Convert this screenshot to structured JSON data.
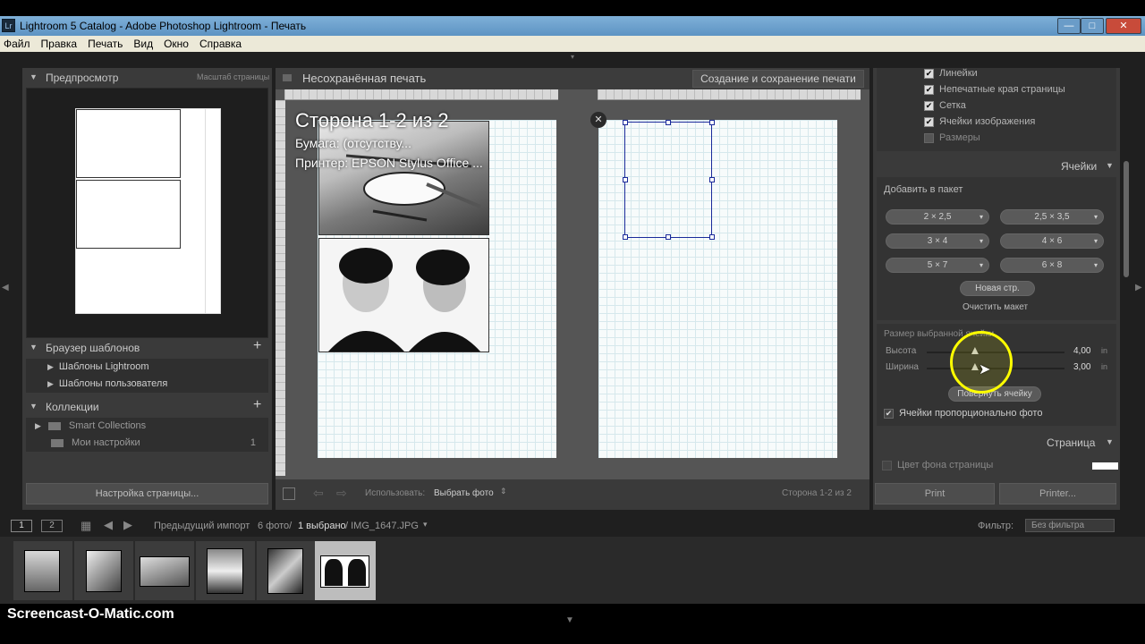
{
  "window": {
    "title": "Lightroom 5 Catalog - Adobe Photoshop Lightroom - Печать",
    "app_icon": "Lr",
    "minimize": "—",
    "maximize": "□",
    "close": "✕"
  },
  "menu": [
    "Файл",
    "Правка",
    "Печать",
    "Вид",
    "Окно",
    "Справка"
  ],
  "left": {
    "preview_title": "Предпросмотр",
    "preview_scale": "Масштаб страницы",
    "template_browser": "Браузер шаблонов",
    "templates": [
      "Шаблоны Lightroom",
      "Шаблоны пользователя"
    ],
    "collections_title": "Коллекции",
    "collections": [
      {
        "name": "Smart Collections",
        "count": ""
      },
      {
        "name": "Мои настройки",
        "count": "1"
      }
    ],
    "page_setup": "Настройка страницы..."
  },
  "center": {
    "title": "Несохранённая печать",
    "create_button": "Создание и сохранение печати",
    "overlay_title": "Сторона 1-2 из 2",
    "overlay_paper": "Бумага:  (отсутству...",
    "overlay_printer": "Принтер:  EPSON Stylus Office ...",
    "toolbar_use_label": "Использовать:",
    "toolbar_use_value": "Выбрать фото",
    "page_indicator": "Сторона 1-2 из 2"
  },
  "right": {
    "guides": [
      {
        "label": "Линейки",
        "checked": true
      },
      {
        "label": "Непечатные края страницы",
        "checked": true
      },
      {
        "label": "Сетка",
        "checked": true
      },
      {
        "label": "Ячейки изображения",
        "checked": true
      },
      {
        "label": "Размеры",
        "checked": false
      }
    ],
    "cells_title": "Ячейки",
    "add_to_package": "Добавить в пакет",
    "sizes": [
      "2 × 2,5",
      "2,5 × 3,5",
      "3 × 4",
      "4 × 6",
      "5 × 7",
      "6 × 8"
    ],
    "new_page": "Новая стр.",
    "clear_layout": "Очистить макет",
    "selected_cell_size": "Размер выбранной ячейки",
    "height_label": "Высота",
    "height_value": "4,00",
    "width_label": "Ширина",
    "width_value": "3,00",
    "unit": "in",
    "height_fraction": 0.35,
    "width_fraction": 0.35,
    "rotate_cell": "Повернуть ячейку",
    "cells_proportional": "Ячейки пропорционально фото",
    "page_title": "Страница",
    "page_bg_color": "Цвет фона страницы",
    "print_button": "Print",
    "printer_button": "Printer..."
  },
  "filmstrip": {
    "view1": "1",
    "view2": "2",
    "source": "Предыдущий импорт",
    "count": "6 фото/",
    "selected": "1 выбрано",
    "filename": "/ IMG_1647.JPG",
    "filter_label": "Фильтр:",
    "filter_value": "Без фильтра",
    "thumbs": 6
  },
  "watermark": "Screencast-O-Matic.com",
  "colors": {
    "accent_cursor": "#ffff00",
    "cell_outline": "#1a2a9a"
  }
}
